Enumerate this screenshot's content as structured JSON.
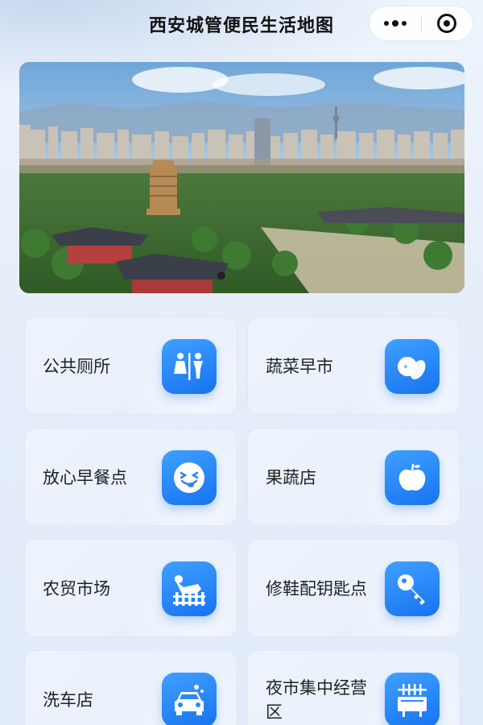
{
  "header": {
    "title": "西安城管便民生活地图"
  },
  "banner": {
    "slide_count": 1,
    "active_slide": 1
  },
  "services": [
    {
      "label": "公共厕所",
      "icon": "toilet-icon"
    },
    {
      "label": "蔬菜早市",
      "icon": "vegetables-icon"
    },
    {
      "label": "放心早餐点",
      "icon": "smiley-face-icon"
    },
    {
      "label": "果蔬店",
      "icon": "apple-icon"
    },
    {
      "label": "农贸市场",
      "icon": "farm-chicken-icon"
    },
    {
      "label": "修鞋配钥匙点",
      "icon": "key-icon"
    },
    {
      "label": "洗车店",
      "icon": "car-wash-icon"
    },
    {
      "label": "夜市集中经营区",
      "icon": "bbq-stall-icon"
    }
  ],
  "colors": {
    "accent": "#1e80f5",
    "card_bg": "#eaf1fc",
    "page_bg": "#e8effa"
  }
}
